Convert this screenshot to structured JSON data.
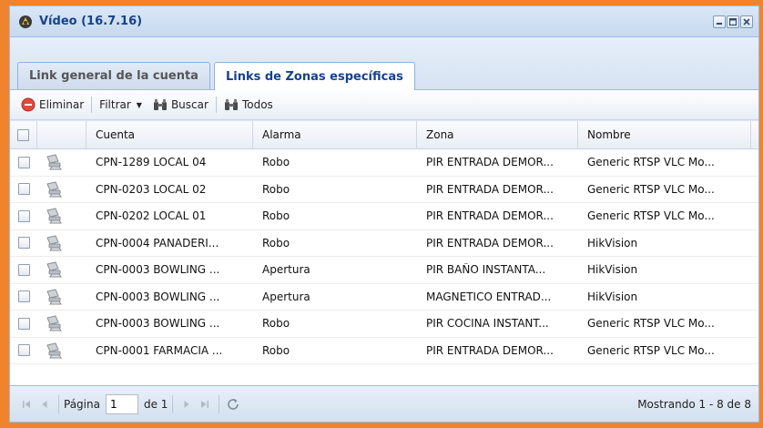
{
  "window": {
    "title": "Vídeo (16.7.16)"
  },
  "tabs": [
    {
      "label": "Link general de la cuenta",
      "active": false
    },
    {
      "label": "Links de Zonas específicas",
      "active": true
    }
  ],
  "toolbar": {
    "delete_label": "Eliminar",
    "filter_label": "Filtrar",
    "search_label": "Buscar",
    "all_label": "Todos"
  },
  "grid": {
    "columns": [
      "Cuenta",
      "Alarma",
      "Zona",
      "Nombre"
    ],
    "rows": [
      {
        "cuenta": "CPN-1289 LOCAL 04",
        "alarma": "Robo",
        "zona": "PIR ENTRADA DEMOR...",
        "nombre": "Generic RTSP VLC Mo..."
      },
      {
        "cuenta": "CPN-0203 LOCAL 02",
        "alarma": "Robo",
        "zona": "PIR ENTRADA DEMOR...",
        "nombre": "Generic RTSP VLC Mo..."
      },
      {
        "cuenta": "CPN-0202 LOCAL 01",
        "alarma": "Robo",
        "zona": "PIR ENTRADA DEMOR...",
        "nombre": "Generic RTSP VLC Mo..."
      },
      {
        "cuenta": "CPN-0004 PANADERI...",
        "alarma": "Robo",
        "zona": "PIR ENTRADA DEMOR...",
        "nombre": "HikVision"
      },
      {
        "cuenta": "CPN-0003 BOWLING ...",
        "alarma": "Apertura",
        "zona": "PIR BAÑO INSTANTA...",
        "nombre": "HikVision"
      },
      {
        "cuenta": "CPN-0003 BOWLING ...",
        "alarma": "Apertura",
        "zona": "MAGNETICO ENTRAD...",
        "nombre": "HikVision"
      },
      {
        "cuenta": "CPN-0003 BOWLING ...",
        "alarma": "Robo",
        "zona": "PIR COCINA INSTANT...",
        "nombre": "Generic RTSP VLC Mo..."
      },
      {
        "cuenta": "CPN-0001 FARMACIA ...",
        "alarma": "Robo",
        "zona": "PIR ENTRADA DEMOR...",
        "nombre": "Generic RTSP VLC Mo..."
      }
    ]
  },
  "pager": {
    "page_label": "Página",
    "page_value": "1",
    "of_label": "de 1",
    "info": "Mostrando 1 - 8 de 8"
  },
  "colors": {
    "frame": "#f0842c",
    "title_text": "#15428b",
    "delete_icon": "#e04a3a"
  }
}
